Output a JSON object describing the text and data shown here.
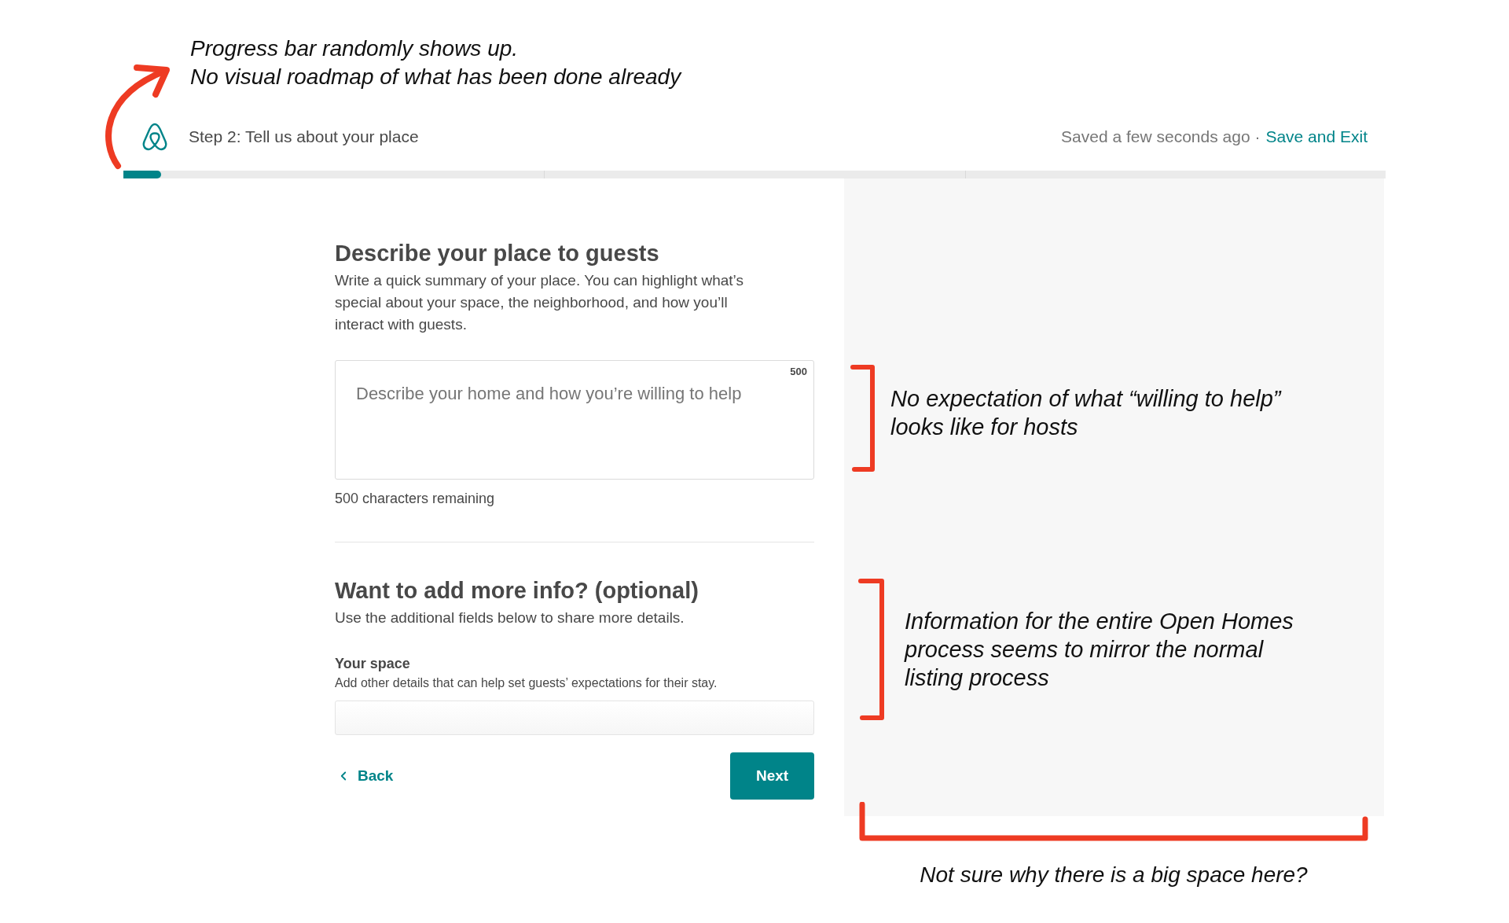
{
  "top_note": {
    "lines": [
      "Progress bar randomly shows up.",
      "No visual roadmap of what has been done already"
    ]
  },
  "header": {
    "step_title": "Step 2: Tell us about your place",
    "save_status": "Saved a few seconds ago ·",
    "save_exit_link": "Save and Exit"
  },
  "progress": {
    "level": 0.03
  },
  "description_section": {
    "heading": "Describe your place to guests",
    "body": "Write a quick summary of your place. You can highlight what’s special about your space, the neighborhood, and how you’ll interact with guests.",
    "field": {
      "placeholder": "Describe your home and how you’re willing to help",
      "counter": "500"
    },
    "remaining": "500 characters remaining"
  },
  "more_info_section": {
    "heading": "Want to add more info? (optional)",
    "body": "Use the additional fields below to share more details.",
    "fields": [
      {
        "label": "Your space",
        "hint": "Add other details that can help set guests’ expectations for their stay."
      }
    ]
  },
  "nav": {
    "back": "Back",
    "next": "Next"
  },
  "side_notes": [
    {
      "text": "No expectation of what “willing to help” looks like for hosts"
    },
    {
      "text": "Information for the entire Open Homes process seems to mirror the normal listing process"
    }
  ],
  "bottom_note": {
    "text": "Not sure why there is a big space here?"
  }
}
